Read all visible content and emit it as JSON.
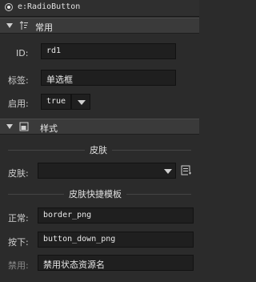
{
  "window": {
    "title": "e:RadioButton"
  },
  "sections": {
    "common": {
      "label": "常用",
      "icon": "sort-icon",
      "id_label": "ID:",
      "id_value": "rd1",
      "tag_label": "标签:",
      "tag_value": "单选框",
      "enabled_label": "启用:",
      "enabled_value": "true"
    },
    "style": {
      "label": "样式",
      "icon": "layout-icon",
      "skin_header": "皮肤",
      "skin_label": "皮肤:",
      "skin_value": "",
      "template_header": "皮肤快捷模板",
      "normal_label": "正常:",
      "normal_value": "border_png",
      "down_label": "按下:",
      "down_value": "button_down_png",
      "disabled_label": "禁用:",
      "disabled_placeholder": "禁用状态资源名"
    }
  }
}
